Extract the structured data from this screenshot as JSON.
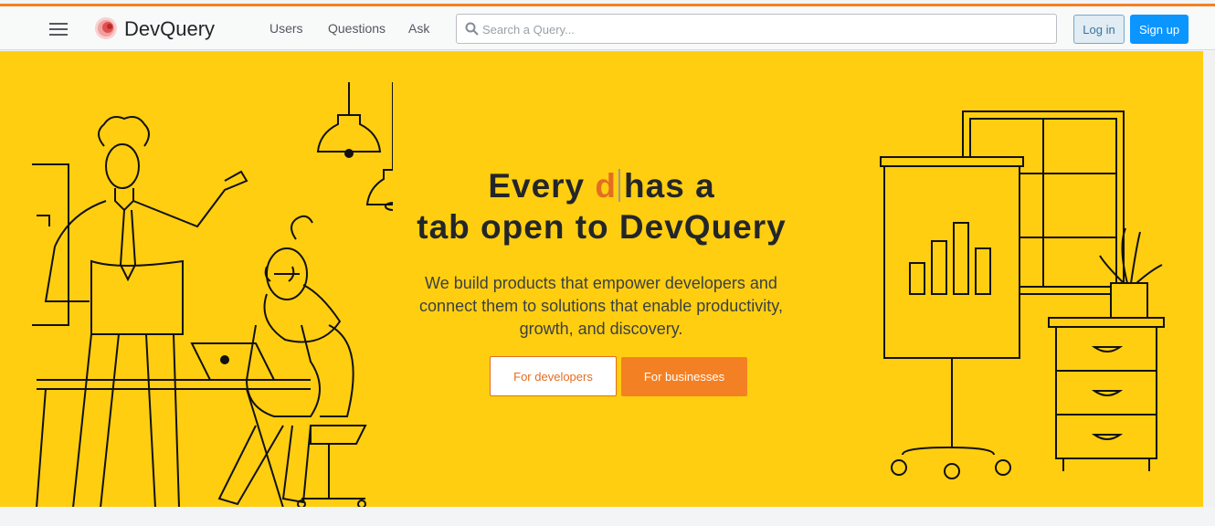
{
  "header": {
    "brand": "DevQuery",
    "nav": [
      "Users",
      "Questions",
      "Ask"
    ],
    "search_placeholder": "Search a Query...",
    "login_label": "Log in",
    "signup_label": "Sign up"
  },
  "hero": {
    "headline_prefix": "Every ",
    "headline_typed": "d",
    "headline_suffix": "has a",
    "headline_line2": "tab open to DevQuery",
    "subtitle": "We build products that empower developers and connect them to solutions that enable productivity, growth, and discovery.",
    "cta_developers": "For developers",
    "cta_businesses": "For businesses"
  },
  "colors": {
    "accent": "#f48024",
    "hero_bg": "#ffce10",
    "primary": "#0a95ff"
  }
}
